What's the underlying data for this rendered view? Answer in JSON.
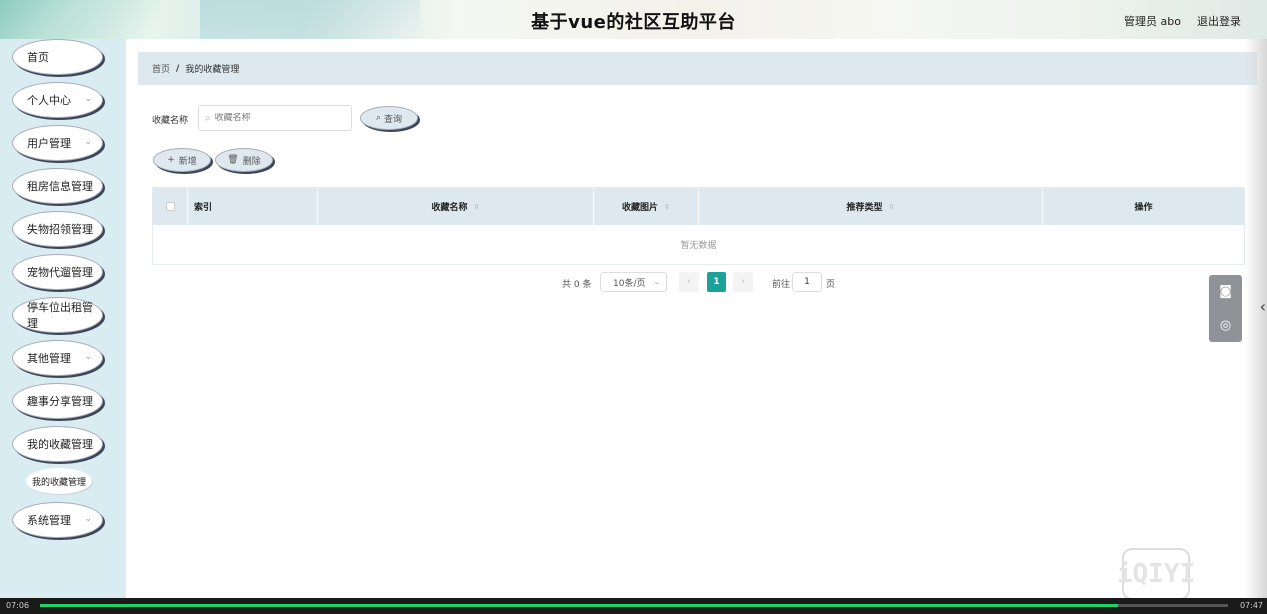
{
  "header": {
    "title": "基于vue的社区互助平台",
    "user": "管理员 abo",
    "logout": "退出登录"
  },
  "sidebar": {
    "items": [
      {
        "label": "首页"
      },
      {
        "label": "个人中心"
      },
      {
        "label": "用户管理"
      },
      {
        "label": "租房信息管理"
      },
      {
        "label": "失物招领管理"
      },
      {
        "label": "宠物代遛管理"
      },
      {
        "label": "停车位出租管理"
      },
      {
        "label": "其他管理"
      },
      {
        "label": "趣事分享管理"
      },
      {
        "label": "我的收藏管理"
      },
      {
        "label": "系统管理"
      }
    ],
    "submenu_active": "我的收藏管理"
  },
  "breadcrumb": {
    "home": "首页",
    "separator": "/",
    "current": "我的收藏管理"
  },
  "search": {
    "label": "收藏名称",
    "placeholder": "收藏名称",
    "button": "查询"
  },
  "actions": {
    "add": "新增",
    "delete": "删除"
  },
  "table": {
    "columns": [
      "索引",
      "收藏名称",
      "收藏图片",
      "推荐类型",
      "操作"
    ],
    "empty_text": "暂无数据"
  },
  "pagination": {
    "total": "共 0 条",
    "page_size": "10条/页",
    "current_page": "1",
    "goto_label": "前往",
    "goto_value": "1",
    "page_suffix": "页"
  },
  "video": {
    "elapsed": "07:06",
    "duration": "07:47",
    "progress": 0.91
  },
  "colors": {
    "accent": "#1ba29a",
    "sidebar_bg": "#d9ecf2",
    "header_bg": "#dde9ef",
    "progress": "#1cd36a"
  }
}
